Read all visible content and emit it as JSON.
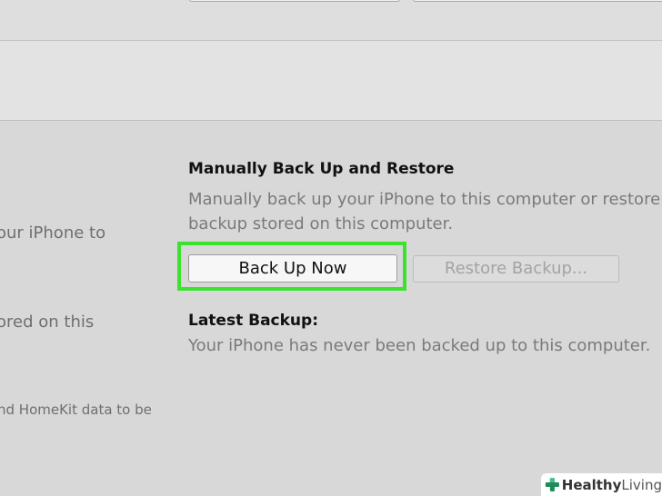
{
  "left_panel": {
    "line1": "our iPhone to",
    "line2": "ored on this",
    "line3": "nd HomeKit data to be"
  },
  "manual": {
    "heading": "Manually Back Up and Restore",
    "description_line1": "Manually back up your iPhone to this computer or restore a",
    "description_line2": "backup stored on this computer.",
    "backup_now_label": "Back Up Now",
    "restore_label": "Restore Backup..."
  },
  "latest": {
    "title": "Latest Backup:",
    "text": "Your iPhone has never been backed up to this computer."
  },
  "watermark": {
    "part1": "Healthy",
    "part2": "Living"
  },
  "colors": {
    "highlight": "#3be22e",
    "background": "#d8d8d8"
  }
}
